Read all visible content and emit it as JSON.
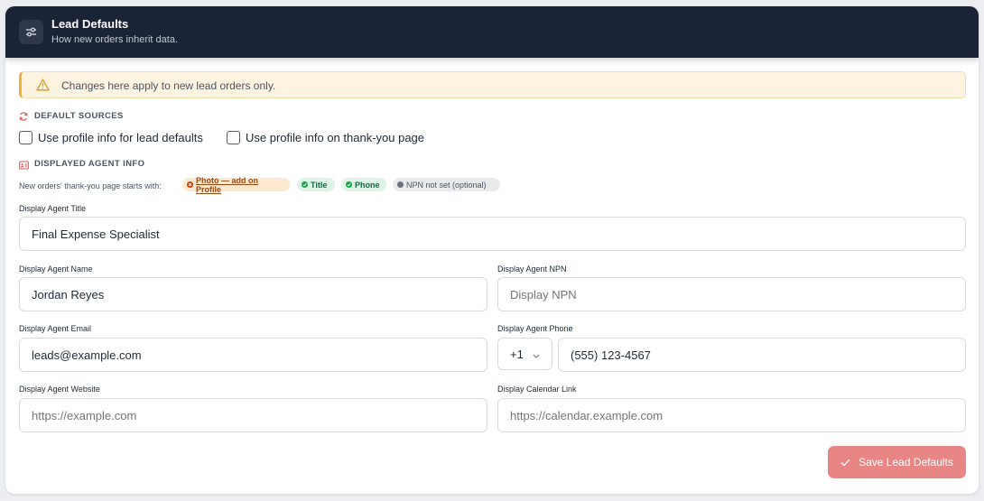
{
  "header": {
    "title": "Lead Defaults",
    "subtitle": "How new orders inherit data."
  },
  "notice": {
    "text": "Changes here apply to new lead orders only."
  },
  "default_sources": {
    "heading": "DEFAULT SOURCES",
    "options": [
      {
        "label": "Use profile info for lead defaults",
        "checked": false
      },
      {
        "label": "Use profile info on thank-you page",
        "checked": false
      }
    ]
  },
  "agent_info": {
    "heading": "DISPLAYED AGENT INFO",
    "starts_with": "New orders' thank-you page starts with:",
    "chips": {
      "photo": "Photo — add on Profile",
      "title": "Title",
      "phone": "Phone",
      "npn": "NPN not set (optional)"
    }
  },
  "fields": {
    "title": {
      "label": "Display Agent Title",
      "value": "Final Expense Specialist",
      "placeholder": ""
    },
    "name": {
      "label": "Display Agent Name",
      "value": "Jordan Reyes",
      "placeholder": ""
    },
    "npn": {
      "label": "Display Agent NPN",
      "value": "",
      "placeholder": "Display NPN"
    },
    "email": {
      "label": "Display Agent Email",
      "value": "leads@example.com",
      "placeholder": ""
    },
    "phone": {
      "label": "Display Agent Phone",
      "country_code": "+1",
      "value": "(555) 123-4567",
      "placeholder": ""
    },
    "website": {
      "label": "Display Agent Website",
      "value": "",
      "placeholder": "https://example.com"
    },
    "calendar": {
      "label": "Display Calendar Link",
      "value": "",
      "placeholder": "https://calendar.example.com"
    }
  },
  "actions": {
    "save_label": "Save Lead Defaults"
  },
  "colors": {
    "header_bg": "#1b2436",
    "accent_red": "#e88585",
    "warning_border": "#eab23b",
    "success_green": "#16a34a"
  },
  "icons": {
    "header": "sliders-icon",
    "notice": "warning-triangle-icon",
    "default_sources": "refresh-icon",
    "agent_info": "id-card-icon",
    "save": "check-icon"
  }
}
